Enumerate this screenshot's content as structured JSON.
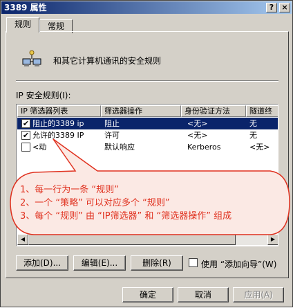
{
  "window": {
    "title": "3389 属性",
    "help_button": "?",
    "close_button": "×"
  },
  "tabs": [
    {
      "label": "规则",
      "active": true
    },
    {
      "label": "常规",
      "active": false
    }
  ],
  "description": "和其它计算机通讯的安全规则",
  "list_label": "IP 安全规则(I):",
  "list": {
    "columns": [
      "IP 筛选器列表",
      "筛选器操作",
      "身份验证方法",
      "隧道终"
    ],
    "rows": [
      {
        "checked": true,
        "name": "阻止的3389 ip",
        "action": "阻止",
        "auth": "<无>",
        "tunnel": "无",
        "selected": true
      },
      {
        "checked": true,
        "name": "允许的3389 IP",
        "action": "许可",
        "auth": "<无>",
        "tunnel": "无",
        "selected": false
      },
      {
        "checked": false,
        "name": "<动",
        "action": "默认响应",
        "auth": "Kerberos",
        "tunnel": "<无>",
        "selected": false
      }
    ]
  },
  "buttons": {
    "add": "添加(D)...",
    "edit": "编辑(E)...",
    "remove": "删除(R)",
    "use_wizard": "使用 “添加向导”(W)"
  },
  "footer": {
    "ok": "确定",
    "cancel": "取消",
    "apply": "应用(A)"
  },
  "annotation": {
    "lines": [
      "1、每一行为一条 “规则”",
      "2、一个 “策略” 可以对应多个 “规则”",
      "3、每个 “规则” 由 “IP筛选器” 和 “筛选器操作” 组成"
    ],
    "color": "#e0311f"
  }
}
